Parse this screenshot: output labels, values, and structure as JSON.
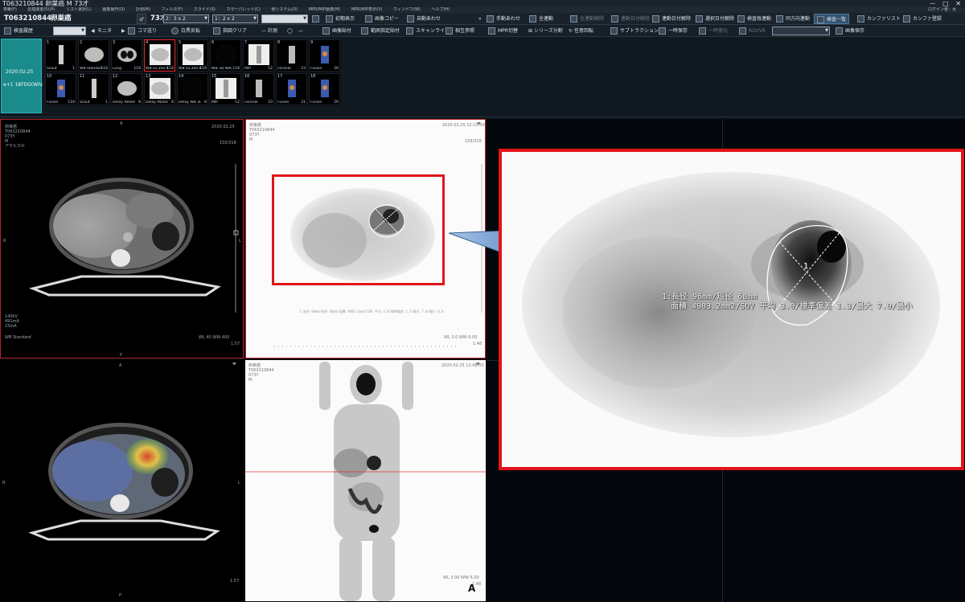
{
  "window": {
    "title": "T063210844 卵巣癌 M 73才",
    "controls": "－ □ ✕"
  },
  "menu": {
    "items": [
      "検索(F)",
      "処理装置(S)(P)",
      "リスト選択(L)",
      "画像操作(O)",
      "計測(M)",
      "フィルタ(F)",
      "スライド(S)",
      "カラーパレット(C)",
      "他システム(O)",
      "MPR/MIP画像(M)",
      "MPR/MIP表示(V)",
      "ウィンドウ(W)",
      "ヘルプ(H)"
    ],
    "user": "ログイン者：太"
  },
  "toolbar1": {
    "patient_id": "T063210844",
    "diagnosis": "卵巣癌",
    "sex_icon": "sex-icon",
    "age": "73才",
    "layout1": "2：3 x 2",
    "layout2": "1：2 x 2",
    "buttons": {
      "initial_display": "初期表示",
      "image_copy": "画像コピー",
      "auto_align": "自動あわせ",
      "manual_align": "手動あわせ",
      "full_link": "全連動",
      "link_release": "全連動解除",
      "link_date_release": "連動日付解除",
      "link_date_set": "連動日付解除",
      "select_date_release": "選択日付解除",
      "study_link": "検査毎連動",
      "same_direction": "同方向連動",
      "study_list": "検査一覧",
      "conference_list": "カンファリスト",
      "conference_register": "カンファ登録"
    }
  },
  "toolbar2": {
    "buttons": {
      "study_history": "検査履歴",
      "monitor": "モニタ",
      "frame_step": "コマ送り",
      "invert": "白黒反転",
      "annotation_clear": "指図クリア",
      "measure": "計測",
      "image_paste": "画像貼付",
      "range_specify": "範囲指定貼付",
      "scanline": "スキャンライン",
      "mutual_ref": "相互参照",
      "mpr_switch": "MPR切替",
      "series_split": "シリーズ分割",
      "free_rotate": "任意回転",
      "subtraction": "サブトラクション",
      "temp_save": "一時保存",
      "temp_restore": "一時復元",
      "roi_vr": "ROI/VR",
      "image_save": "画像保存"
    }
  },
  "study": {
    "date": "2020.02.25",
    "desc": "e+1 18FDG(Who"
  },
  "series": [
    {
      "num": "1",
      "label": "Scout",
      "count": "1"
    },
    {
      "num": "2",
      "label": "WB Standard",
      "count": "118"
    },
    {
      "num": "3",
      "label": "Lung",
      "count": "118"
    },
    {
      "num": "4",
      "label": "WB GC300 B...",
      "count": "118"
    },
    {
      "num": "5",
      "label": "WB GC300 B...",
      "count": "118"
    },
    {
      "num": "6",
      "label": "WB 3D NAC",
      "count": "118"
    },
    {
      "num": "7",
      "label": "MIP",
      "count": "12"
    },
    {
      "num": "8",
      "label": "coronal",
      "count": "23"
    },
    {
      "num": "9",
      "label": "Fusion",
      "count": "26"
    },
    {
      "num": "10",
      "label": "Fusion",
      "count": "118"
    },
    {
      "num": "11",
      "label": "Scout",
      "count": "1"
    },
    {
      "num": "12",
      "label": "Delay Abdom",
      "count": "8"
    },
    {
      "num": "13",
      "label": "Delay Abdom",
      "count": "8"
    },
    {
      "num": "14",
      "label": "Delay WB 3D",
      "count": "8"
    },
    {
      "num": "15",
      "label": "MIP",
      "count": "12"
    },
    {
      "num": "16",
      "label": "coronal",
      "count": "23"
    },
    {
      "num": "17",
      "label": "Fusion",
      "count": "21"
    },
    {
      "num": "18",
      "label": "Fusion",
      "count": "26"
    }
  ],
  "panes": {
    "ct": {
      "name": "卵巣癌\nT063210844\n073Y\nM\nアサヒカセ",
      "date": "2020.02.25",
      "index": "150/318",
      "params": "140kV\n491mA\n23mA",
      "series": "WB Standard",
      "wl": "WL 40 WW 400",
      "zoom": "1.57",
      "orient_top": "A",
      "orient_left": "R",
      "orient_right": "L",
      "orient_bottom": "P"
    },
    "pet": {
      "name": "卵巣癌\nT063210844\n073Y\nM",
      "date": "2020.02.25 12:10:00",
      "index": "156/318",
      "measure": "1:長径 96mm/短径 68mm/面積 4903.2mm2/SUV 平均 3.0/標準偏差 1.3/最大 7.0/最小 0.0",
      "wl": "WL 3.0 WW 6.00",
      "zoom": "1.48"
    },
    "fusion": {
      "orient_top": "A",
      "orient_left": "R",
      "orient_right": "L",
      "orient_bottom": "P",
      "zoom": "1.57"
    },
    "mip": {
      "name": "卵巣癌\nT063210844\n073Y\nM",
      "date": "2020.02.25 12:48:03",
      "wl": "WL 3.00 WW 6.00",
      "zoom": "1.48"
    }
  },
  "zoom_box": {
    "roi_num": "1",
    "line1": "1:長径 96mm/短径 68mm",
    "line2": "面積 4903.2mm2/SUV 平均 3.0/標準偏差 1.3/最大 7.0/最小"
  },
  "figure_label": "A",
  "colors": {
    "highlight": "#e2141a",
    "study_tab": "#1a8b8b",
    "pointer": "#5d8ec8"
  }
}
